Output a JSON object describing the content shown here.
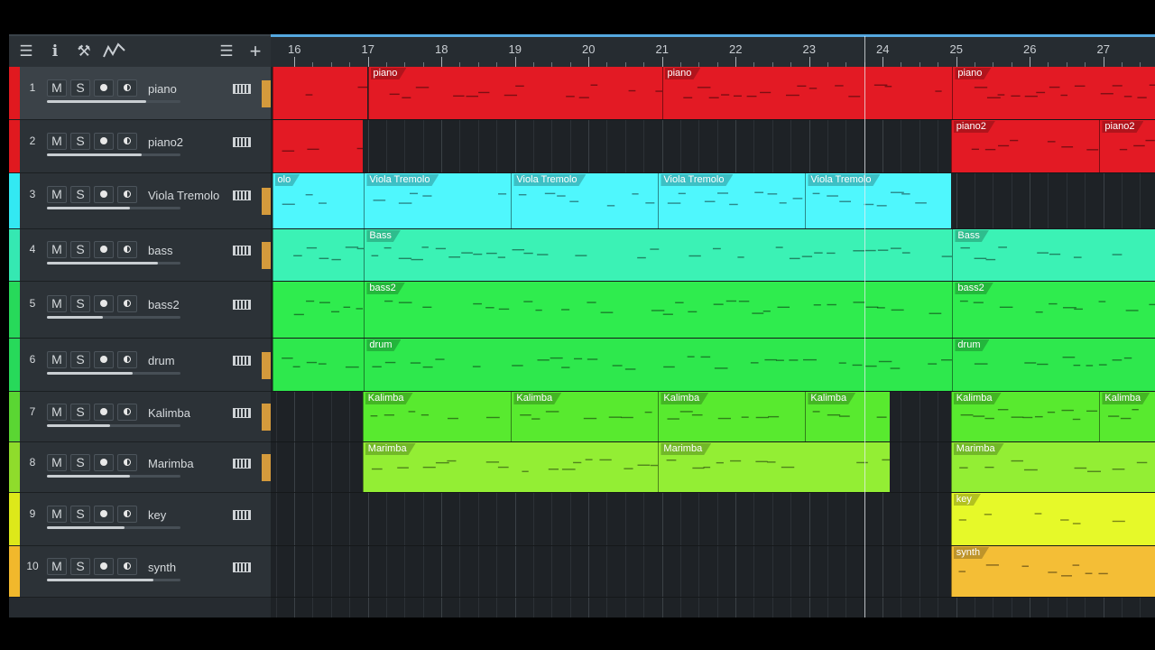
{
  "toolbar": {
    "menu_icon": "hamburger-menu-icon",
    "inspector_icon": "info-icon",
    "tools_icon": "wrench-icon",
    "automation_icon": "automation-curve-icon",
    "list_icon": "track-list-icon",
    "add_icon": "plus-icon"
  },
  "ruler": {
    "bars": [
      "16",
      "17",
      "18",
      "19",
      "20",
      "21",
      "22",
      "23",
      "24",
      "25",
      "26",
      "27"
    ]
  },
  "buttons": {
    "mute": "M",
    "solo": "S"
  },
  "tracks": [
    {
      "number": "1",
      "name": "piano",
      "color": "#e0191f",
      "volume": 0.74,
      "selected": true,
      "orange": true
    },
    {
      "number": "2",
      "name": "piano2",
      "color": "#e0191f",
      "volume": 0.71,
      "selected": false,
      "orange": false
    },
    {
      "number": "3",
      "name": "Viola Tremolo",
      "color": "#33e8f2",
      "volume": 0.62,
      "selected": false,
      "orange": true
    },
    {
      "number": "4",
      "name": "bass",
      "color": "#35e8b2",
      "volume": 0.83,
      "selected": false,
      "orange": true
    },
    {
      "number": "5",
      "name": "bass2",
      "color": "#27d95a",
      "volume": 0.42,
      "selected": false,
      "orange": false
    },
    {
      "number": "6",
      "name": "drum",
      "color": "#27d95a",
      "volume": 0.64,
      "selected": false,
      "orange": true
    },
    {
      "number": "7",
      "name": "Kalimba",
      "color": "#5ad633",
      "volume": 0.47,
      "selected": false,
      "orange": true
    },
    {
      "number": "8",
      "name": "Marimba",
      "color": "#8fdc2c",
      "volume": 0.62,
      "selected": false,
      "orange": true
    },
    {
      "number": "9",
      "name": "key",
      "color": "#dde81a",
      "volume": 0.58,
      "selected": false,
      "orange": false
    },
    {
      "number": "10",
      "name": "synth",
      "color": "#f1b82c",
      "volume": 0.8,
      "selected": false,
      "orange": false
    }
  ],
  "parts": [
    {
      "track": 0,
      "label": "piano",
      "start": 17,
      "end": 21,
      "color": "#e31a24"
    },
    {
      "track": 0,
      "label": "piano",
      "start": 21,
      "end": 24.95,
      "color": "#e31a24"
    },
    {
      "track": 0,
      "label": "piano",
      "start": 24.95,
      "end": 28.2,
      "color": "#e31a24"
    },
    {
      "track": 0,
      "label": "",
      "start": 15.7,
      "end": 17,
      "color": "#e31a24"
    },
    {
      "track": 1,
      "label": "",
      "start": 15.7,
      "end": 16.93,
      "color": "#e31a24"
    },
    {
      "track": 1,
      "label": "piano2",
      "start": 24.93,
      "end": 26.95,
      "color": "#e31a24"
    },
    {
      "track": 1,
      "label": "piano2",
      "start": 26.95,
      "end": 28.2,
      "color": "#e31a24"
    },
    {
      "track": 2,
      "label": "olo",
      "start": 15.7,
      "end": 16.95,
      "color": "#4ff7fd"
    },
    {
      "track": 2,
      "label": "Viola Tremolo",
      "start": 16.95,
      "end": 18.95,
      "color": "#4ff7fd"
    },
    {
      "track": 2,
      "label": "Viola Tremolo",
      "start": 18.95,
      "end": 20.95,
      "color": "#4ff7fd"
    },
    {
      "track": 2,
      "label": "Viola Tremolo",
      "start": 20.95,
      "end": 22.95,
      "color": "#4ff7fd"
    },
    {
      "track": 2,
      "label": "Viola Tremolo",
      "start": 22.95,
      "end": 24.93,
      "color": "#4ff7fd"
    },
    {
      "track": 3,
      "label": "",
      "start": 15.7,
      "end": 16.95,
      "color": "#3bf2b5"
    },
    {
      "track": 3,
      "label": "Bass",
      "start": 16.95,
      "end": 24.95,
      "color": "#3bf2b5"
    },
    {
      "track": 3,
      "label": "Bass",
      "start": 24.95,
      "end": 28.2,
      "color": "#3bf2b5"
    },
    {
      "track": 4,
      "label": "",
      "start": 15.7,
      "end": 16.95,
      "color": "#2fec4e"
    },
    {
      "track": 4,
      "label": "bass2",
      "start": 16.95,
      "end": 24.95,
      "color": "#2fec4e"
    },
    {
      "track": 4,
      "label": "bass2",
      "start": 24.95,
      "end": 28.2,
      "color": "#2fec4e"
    },
    {
      "track": 5,
      "label": "",
      "start": 15.7,
      "end": 16.95,
      "color": "#2ee84d"
    },
    {
      "track": 5,
      "label": "drum",
      "start": 16.95,
      "end": 24.95,
      "color": "#2ee84d"
    },
    {
      "track": 5,
      "label": "drum",
      "start": 24.95,
      "end": 28.2,
      "color": "#2ee84d"
    },
    {
      "track": 6,
      "label": "Kalimba",
      "start": 16.93,
      "end": 18.95,
      "color": "#58ea2f"
    },
    {
      "track": 6,
      "label": "Kalimba",
      "start": 18.95,
      "end": 20.95,
      "color": "#58ea2f"
    },
    {
      "track": 6,
      "label": "Kalimba",
      "start": 20.95,
      "end": 22.95,
      "color": "#58ea2f"
    },
    {
      "track": 6,
      "label": "Kalimba",
      "start": 22.95,
      "end": 24.1,
      "color": "#58ea2f"
    },
    {
      "track": 6,
      "label": "Kalimba",
      "start": 24.93,
      "end": 26.95,
      "color": "#58ea2f"
    },
    {
      "track": 6,
      "label": "Kalimba",
      "start": 26.95,
      "end": 28.2,
      "color": "#58ea2f"
    },
    {
      "track": 7,
      "label": "Marimba",
      "start": 16.93,
      "end": 20.95,
      "color": "#93ee34"
    },
    {
      "track": 7,
      "label": "Marimba",
      "start": 20.95,
      "end": 24.1,
      "color": "#93ee34"
    },
    {
      "track": 7,
      "label": "Marimba",
      "start": 24.93,
      "end": 28.2,
      "color": "#93ee34"
    },
    {
      "track": 8,
      "label": "key",
      "start": 24.93,
      "end": 28.2,
      "color": "#e6f929"
    },
    {
      "track": 9,
      "label": "synth",
      "start": 24.93,
      "end": 28.2,
      "color": "#f4be36"
    }
  ],
  "playhead_bar": 23.75
}
